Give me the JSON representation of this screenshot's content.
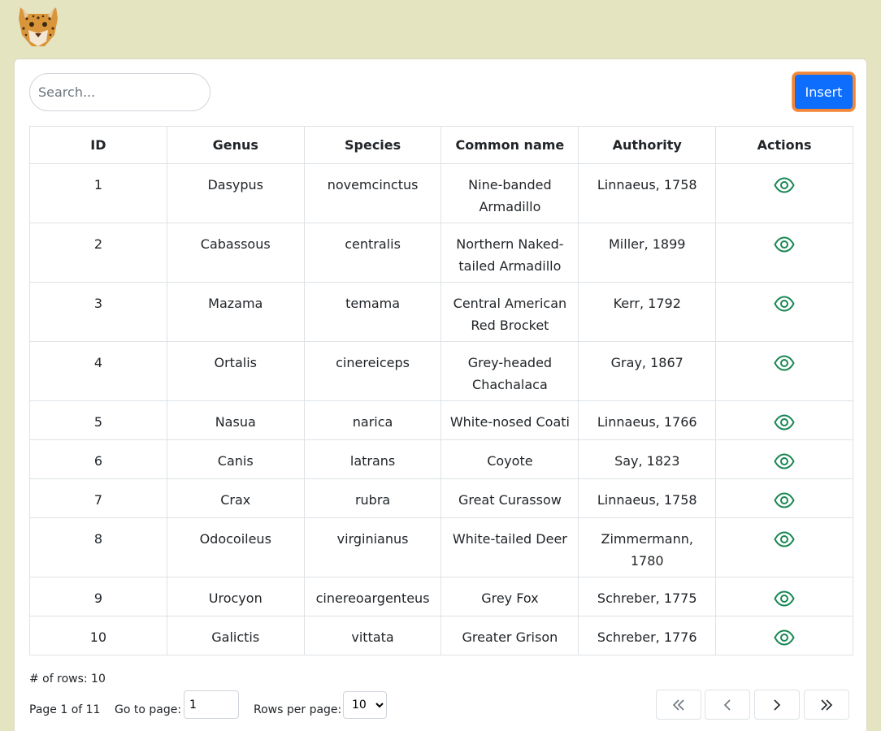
{
  "search": {
    "placeholder": "Search..."
  },
  "toolbar": {
    "insert_label": "Insert"
  },
  "table": {
    "headers": [
      "ID",
      "Genus",
      "Species",
      "Common name",
      "Authority",
      "Actions"
    ],
    "rows": [
      {
        "id": "1",
        "genus": "Dasypus",
        "species": "novemcinctus",
        "common": "Nine-banded Armadillo",
        "authority": "Linnaeus, 1758"
      },
      {
        "id": "2",
        "genus": "Cabassous",
        "species": "centralis",
        "common": "Northern Naked-tailed Armadillo",
        "authority": "Miller, 1899"
      },
      {
        "id": "3",
        "genus": "Mazama",
        "species": "temama",
        "common": "Central American Red Brocket",
        "authority": "Kerr, 1792"
      },
      {
        "id": "4",
        "genus": "Ortalis",
        "species": "cinereiceps",
        "common": "Grey-headed Chachalaca",
        "authority": "Gray, 1867"
      },
      {
        "id": "5",
        "genus": "Nasua",
        "species": "narica",
        "common": "White-nosed Coati",
        "authority": "Linnaeus, 1766"
      },
      {
        "id": "6",
        "genus": "Canis",
        "species": "latrans",
        "common": "Coyote",
        "authority": "Say, 1823"
      },
      {
        "id": "7",
        "genus": "Crax",
        "species": "rubra",
        "common": "Great Curassow",
        "authority": "Linnaeus, 1758"
      },
      {
        "id": "8",
        "genus": "Odocoileus",
        "species": "virginianus",
        "common": "White-tailed Deer",
        "authority": "Zimmermann, 1780"
      },
      {
        "id": "9",
        "genus": "Urocyon",
        "species": "cinereoargenteus",
        "common": "Grey Fox",
        "authority": "Schreber, 1775"
      },
      {
        "id": "10",
        "genus": "Galictis",
        "species": "vittata",
        "common": "Greater Grison",
        "authority": "Schreber, 1776"
      }
    ],
    "action_icon": "eye-icon",
    "action_color": "#198754"
  },
  "footer": {
    "rows_count": "# of rows: 10",
    "page_info": "Page 1 of 11",
    "goto_label": "Go to page:",
    "goto_value": "1",
    "rows_per_page_label": "Rows per page:",
    "rows_per_page_value": "10"
  },
  "pagination_icons": [
    "first-page-icon",
    "previous-page-icon",
    "next-page-icon",
    "last-page-icon"
  ],
  "colors": {
    "background": "#e4e4c0",
    "accent": "#0d6efd",
    "insert_focus_ring": "#f0873a"
  }
}
